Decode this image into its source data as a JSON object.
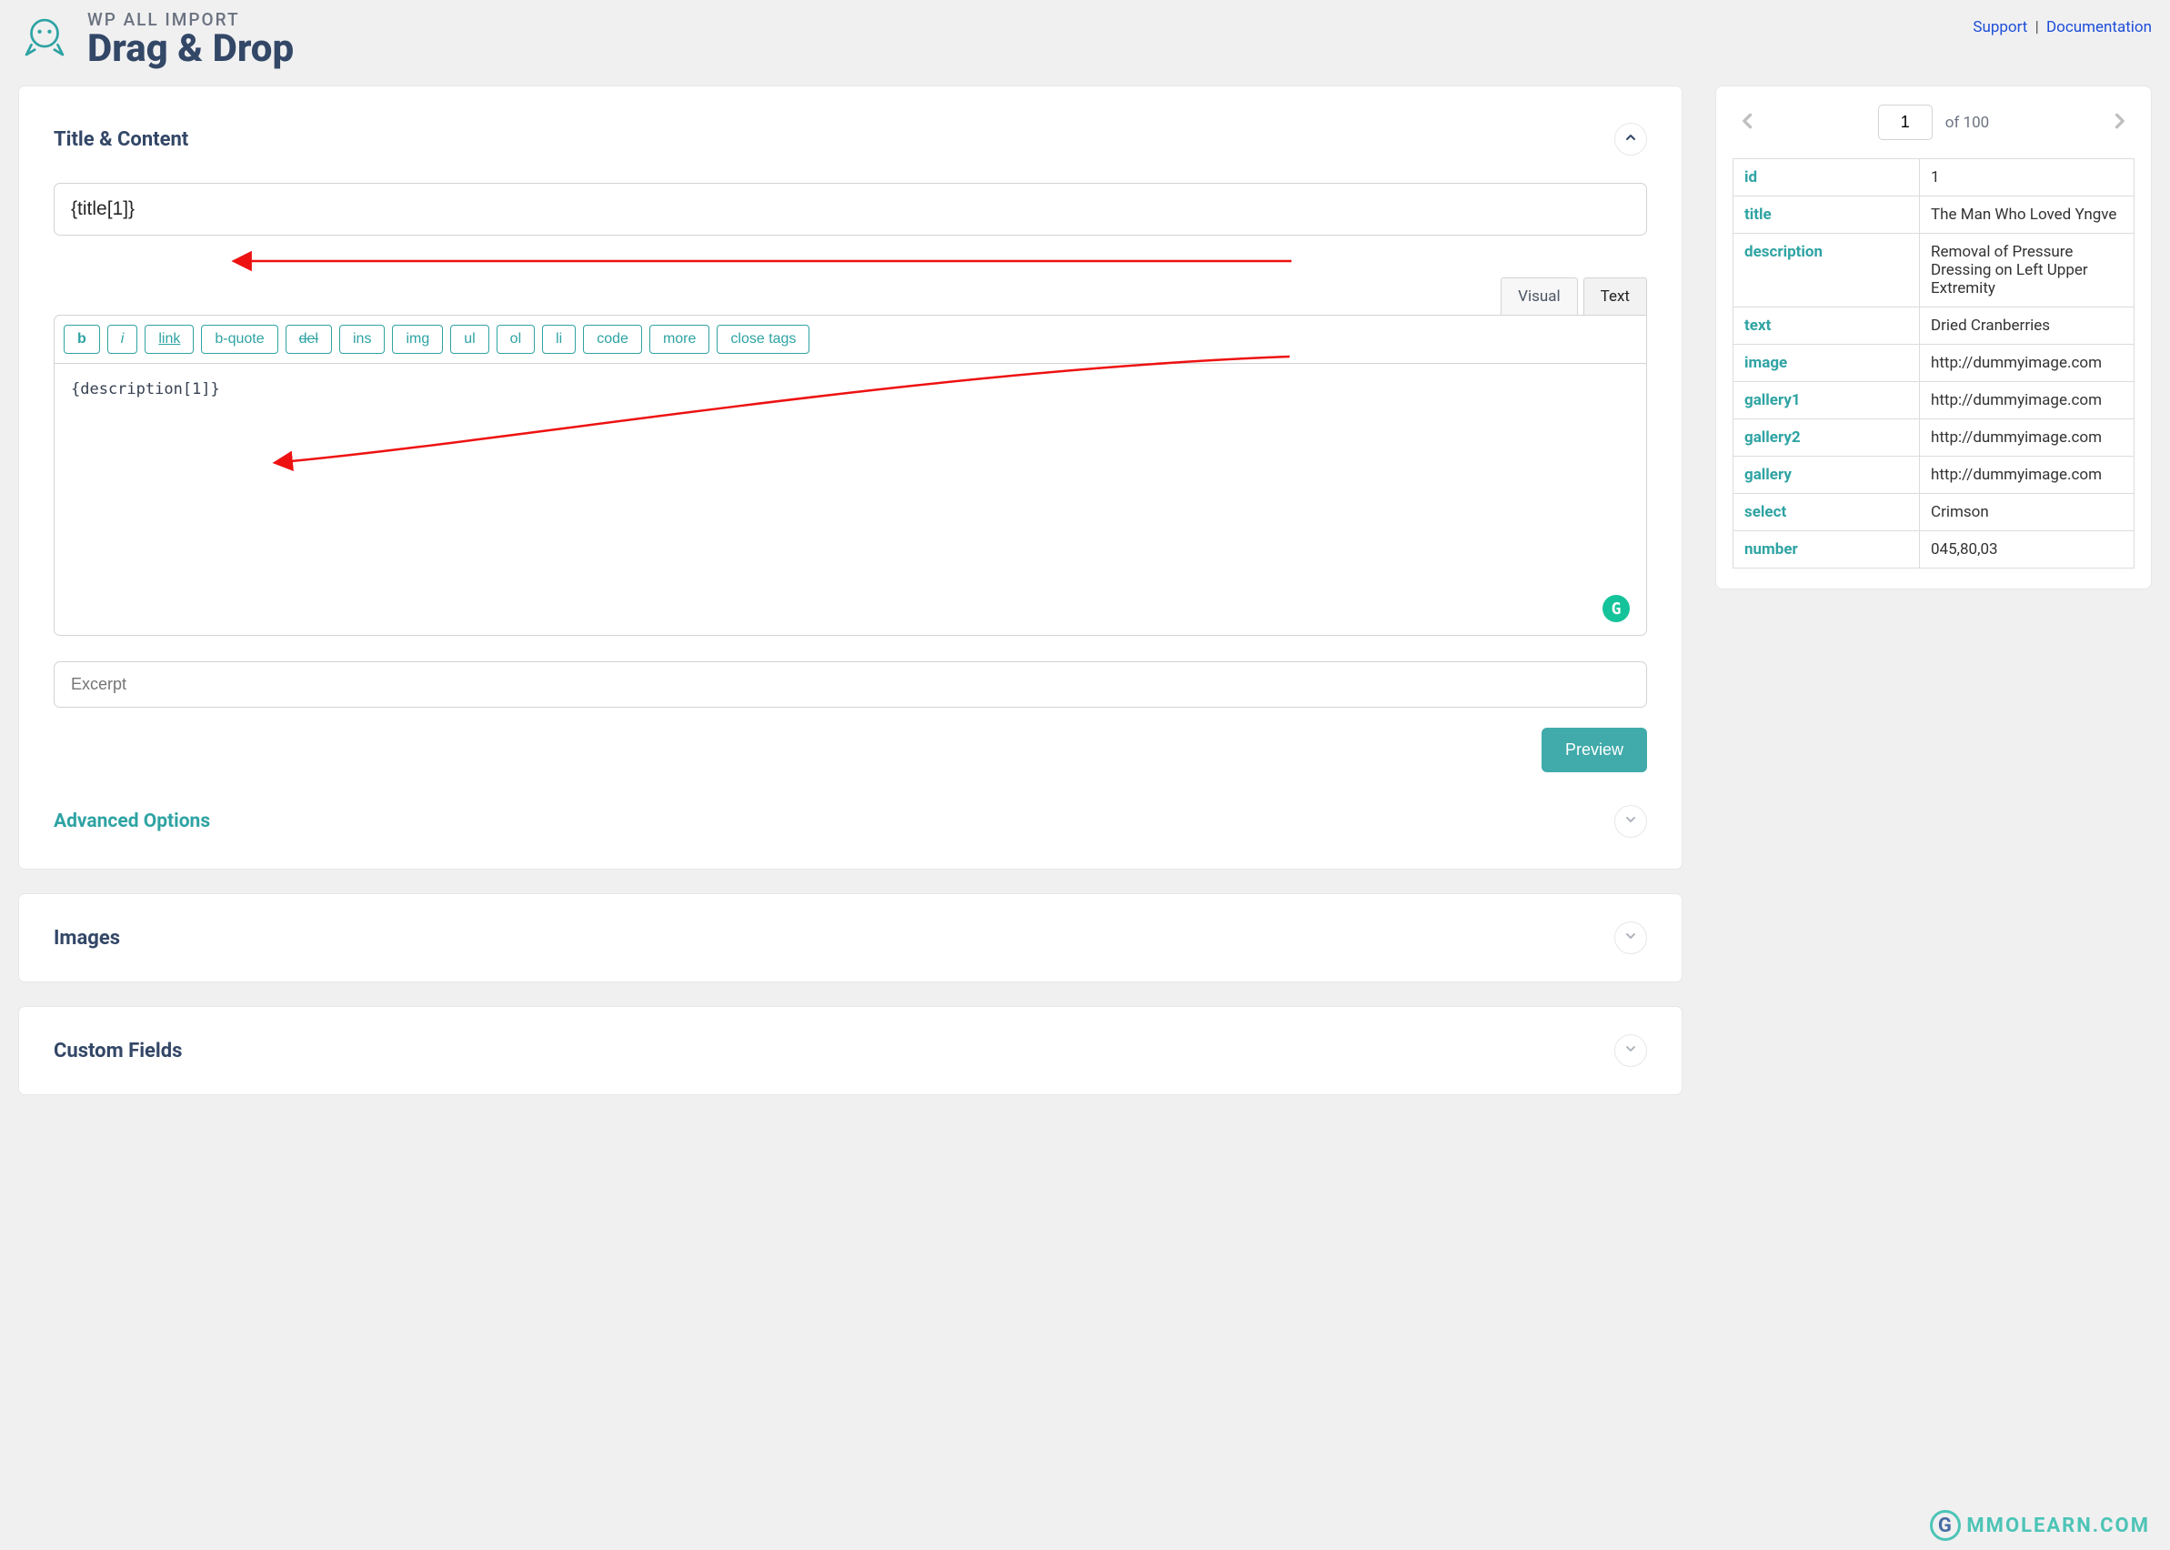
{
  "header": {
    "eyebrow": "WP ALL IMPORT",
    "title": "Drag & Drop",
    "links": {
      "support": "Support",
      "documentation": "Documentation"
    }
  },
  "titleContent": {
    "section_label": "Title & Content",
    "title_value": "{title[1]}",
    "tabs": {
      "visual": "Visual",
      "text": "Text"
    },
    "toolbar": {
      "b": "b",
      "i": "i",
      "link": "link",
      "bquote": "b-quote",
      "del": "del",
      "ins": "ins",
      "img": "img",
      "ul": "ul",
      "ol": "ol",
      "li": "li",
      "code": "code",
      "more": "more",
      "close_tags": "close tags"
    },
    "body_value": "{description[1]}",
    "excerpt_placeholder": "Excerpt",
    "preview_label": "Preview",
    "advanced_label": "Advanced Options"
  },
  "collapsedSections": {
    "images": "Images",
    "custom_fields": "Custom Fields"
  },
  "sidebar": {
    "page_value": "1",
    "of_text": "of 100",
    "rows": [
      {
        "key": "id",
        "val": "1"
      },
      {
        "key": "title",
        "val": "The Man Who Loved Yngve",
        "wrap": true
      },
      {
        "key": "description",
        "val": "Removal of Pressure Dressing on Left Upper Extremity",
        "wrap": true
      },
      {
        "key": "text",
        "val": "Dried Cranberries"
      },
      {
        "key": "image",
        "val": "http://dummyimage.com"
      },
      {
        "key": "gallery1",
        "val": "http://dummyimage.com"
      },
      {
        "key": "gallery2",
        "val": "http://dummyimage.com"
      },
      {
        "key": "gallery",
        "val": "http://dummyimage.com"
      },
      {
        "key": "select",
        "val": "Crimson"
      },
      {
        "key": "number",
        "val": "045,80,03"
      }
    ]
  },
  "watermark": "MMOLEARN.COM"
}
